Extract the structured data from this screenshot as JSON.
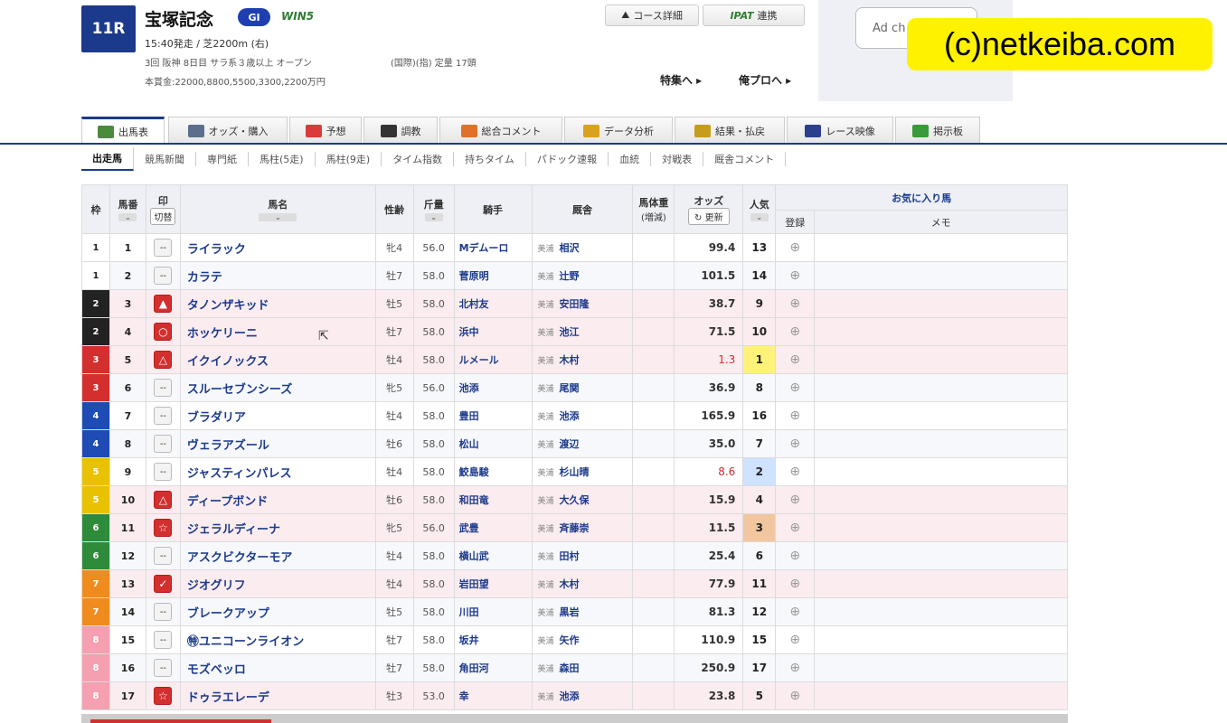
{
  "race": {
    "number": "11R",
    "title": "宝塚記念",
    "grade": "GI",
    "win5": "WIN5",
    "start_info": "15:40発走 / 芝2200m (右)",
    "condition": "3回 阪神 8日目 サラ系３歳以上 オープン",
    "condition2": "(国際)(指) 定量 17頭",
    "prize": "本賞金:22000,8800,5500,3300,2200万円"
  },
  "header": {
    "course_btn": "コース詳細",
    "ipat_logo": "IPAT",
    "ipat_btn": "連携",
    "feature_link": "特集へ ▸",
    "pro_link": "俺プロへ ▸",
    "ad_choice": "Ad ch",
    "watermark": "(c)netkeiba.com"
  },
  "tabs": [
    {
      "label": "出馬表",
      "color": "#4c8a3c"
    },
    {
      "label": "オッズ・購入",
      "color": "#5b6f8c"
    },
    {
      "label": "予想",
      "color": "#d93b3b"
    },
    {
      "label": "調教",
      "color": "#333333"
    },
    {
      "label": "総合コメント",
      "color": "#e0702a"
    },
    {
      "label": "データ分析",
      "color": "#d9a21e"
    },
    {
      "label": "結果・払戻",
      "color": "#c79b1e"
    },
    {
      "label": "レース映像",
      "color": "#2b3f8c"
    },
    {
      "label": "掲示板",
      "color": "#3a9a3a"
    }
  ],
  "subtabs": [
    "出走馬",
    "競馬新聞",
    "専門紙",
    "馬柱(5走)",
    "馬柱(9走)",
    "タイム指数",
    "持ちタイム",
    "パドック速報",
    "血統",
    "対戦表",
    "厩舎コメント"
  ],
  "table": {
    "headers": {
      "waku": "枠",
      "umaban": "馬番",
      "mark": "印",
      "kiri": "切替",
      "name": "馬名",
      "sexage": "性齢",
      "weight": "斤量",
      "jockey": "騎手",
      "trainer": "厩舎",
      "bodyweight": "馬体重",
      "bodyweight_sub": "(増減)",
      "odds": "オッズ",
      "update": "更新",
      "popularity": "人気",
      "favorites": "お気に入り馬",
      "register": "登録",
      "memo": "メモ"
    },
    "rows": [
      {
        "waku": "1",
        "umaban": "1",
        "mark": "--",
        "name": "ライラック",
        "sexage": "牝4",
        "weight": "56.0",
        "jockey": "Mデムーロ",
        "region": "美浦",
        "trainer": "相沢",
        "odds": "99.4",
        "pop": "13"
      },
      {
        "waku": "1",
        "umaban": "2",
        "mark": "--",
        "name": "カラテ",
        "sexage": "牡7",
        "weight": "58.0",
        "jockey": "菅原明",
        "region": "美浦",
        "trainer": "辻野",
        "odds": "101.5",
        "pop": "14"
      },
      {
        "waku": "2",
        "umaban": "3",
        "mark": "▲",
        "name": "タノンザキッド",
        "sexage": "牡5",
        "weight": "58.0",
        "jockey": "北村友",
        "region": "美浦",
        "trainer": "安田隆",
        "odds": "38.7",
        "pop": "9"
      },
      {
        "waku": "2",
        "umaban": "4",
        "mark": "○",
        "name": "ホッケリーニ",
        "sexage": "牡7",
        "weight": "58.0",
        "jockey": "浜中",
        "region": "美浦",
        "trainer": "池江",
        "odds": "71.5",
        "pop": "10"
      },
      {
        "waku": "3",
        "umaban": "5",
        "mark": "△",
        "name": "イクイノックス",
        "sexage": "牡4",
        "weight": "58.0",
        "jockey": "ルメール",
        "region": "美浦",
        "trainer": "木村",
        "odds": "1.3",
        "pop": "1"
      },
      {
        "waku": "3",
        "umaban": "6",
        "mark": "--",
        "name": "スルーセブンシーズ",
        "sexage": "牝5",
        "weight": "56.0",
        "jockey": "池添",
        "region": "美浦",
        "trainer": "尾関",
        "odds": "36.9",
        "pop": "8"
      },
      {
        "waku": "4",
        "umaban": "7",
        "mark": "--",
        "name": "ブラダリア",
        "sexage": "牡4",
        "weight": "58.0",
        "jockey": "豊田",
        "region": "美浦",
        "trainer": "池添",
        "odds": "165.9",
        "pop": "16"
      },
      {
        "waku": "4",
        "umaban": "8",
        "mark": "--",
        "name": "ヴェラアズール",
        "sexage": "牡6",
        "weight": "58.0",
        "jockey": "松山",
        "region": "美浦",
        "trainer": "渡辺",
        "odds": "35.0",
        "pop": "7"
      },
      {
        "waku": "5",
        "umaban": "9",
        "mark": "--",
        "name": "ジャスティンパレス",
        "sexage": "牡4",
        "weight": "58.0",
        "jockey": "鮫島駿",
        "region": "美浦",
        "trainer": "杉山晴",
        "odds": "8.6",
        "pop": "2"
      },
      {
        "waku": "5",
        "umaban": "10",
        "mark": "△",
        "name": "ディープボンド",
        "sexage": "牡6",
        "weight": "58.0",
        "jockey": "和田竜",
        "region": "美浦",
        "trainer": "大久保",
        "odds": "15.9",
        "pop": "4"
      },
      {
        "waku": "6",
        "umaban": "11",
        "mark": "☆",
        "name": "ジェラルディーナ",
        "sexage": "牝5",
        "weight": "56.0",
        "jockey": "武豊",
        "region": "美浦",
        "trainer": "斉藤崇",
        "odds": "11.5",
        "pop": "3"
      },
      {
        "waku": "6",
        "umaban": "12",
        "mark": "--",
        "name": "アスクビクターモア",
        "sexage": "牡4",
        "weight": "58.0",
        "jockey": "横山武",
        "region": "美浦",
        "trainer": "田村",
        "odds": "25.4",
        "pop": "6"
      },
      {
        "waku": "7",
        "umaban": "13",
        "mark": "✓",
        "name": "ジオグリフ",
        "sexage": "牡4",
        "weight": "58.0",
        "jockey": "岩田望",
        "region": "美浦",
        "trainer": "木村",
        "odds": "77.9",
        "pop": "11"
      },
      {
        "waku": "7",
        "umaban": "14",
        "mark": "--",
        "name": "ブレークアップ",
        "sexage": "牡5",
        "weight": "58.0",
        "jockey": "川田",
        "region": "美浦",
        "trainer": "黒岩",
        "odds": "81.3",
        "pop": "12"
      },
      {
        "waku": "8",
        "umaban": "15",
        "mark": "--",
        "name": "㊕ユニコーンライオン",
        "sexage": "牡7",
        "weight": "58.0",
        "jockey": "坂井",
        "region": "美浦",
        "trainer": "矢作",
        "odds": "110.9",
        "pop": "15"
      },
      {
        "waku": "8",
        "umaban": "16",
        "mark": "--",
        "name": "モズベッロ",
        "sexage": "牡7",
        "weight": "58.0",
        "jockey": "角田河",
        "region": "美浦",
        "trainer": "森田",
        "odds": "250.9",
        "pop": "17"
      },
      {
        "waku": "8",
        "umaban": "17",
        "mark": "☆",
        "name": "ドゥラエレーデ",
        "sexage": "牡3",
        "weight": "53.0",
        "jockey": "幸",
        "region": "美浦",
        "trainer": "池添",
        "odds": "23.8",
        "pop": "5"
      }
    ]
  },
  "cursor_icon": "pointer-icon"
}
